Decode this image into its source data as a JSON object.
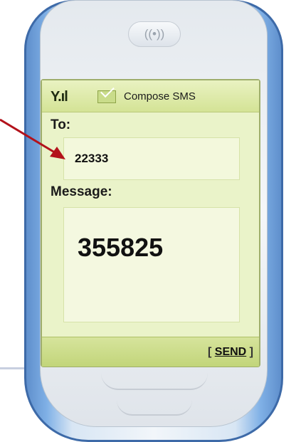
{
  "earpiece": {
    "icon": "((•))"
  },
  "status": {
    "signal_icon": "signal-icon",
    "envelope_icon": "envelope-icon",
    "title": "Compose SMS"
  },
  "compose": {
    "to_label": "To:",
    "to_value": "22333",
    "message_label": "Message:",
    "message_value": "355825"
  },
  "softkeys": {
    "send_open": "[ ",
    "send_label": "SEND",
    "send_close": " ]"
  },
  "colors": {
    "arrow": "#b3121b",
    "screen_bg": "#eaf3c9",
    "phone_blue": "#3d6aa8"
  }
}
